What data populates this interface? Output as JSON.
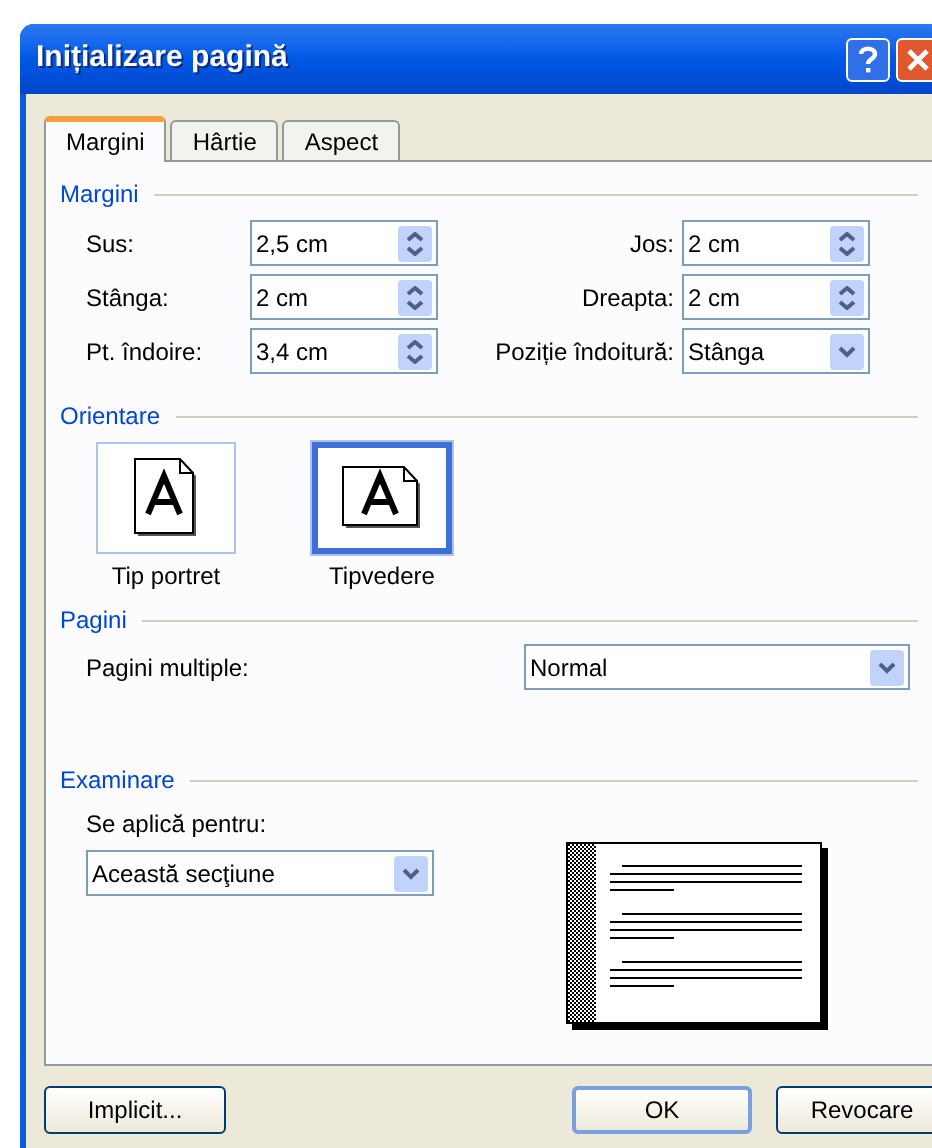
{
  "window": {
    "title": "Inițializare pagină"
  },
  "tabs": [
    {
      "label": "Margini",
      "selected": true
    },
    {
      "label": "Hârtie",
      "selected": false
    },
    {
      "label": "Aspect",
      "selected": false
    }
  ],
  "margins": {
    "heading": "Margini",
    "fields": [
      {
        "label": "Sus:",
        "value": "2,5 cm",
        "kind": "spin"
      },
      {
        "label": "Jos:",
        "value": "2 cm",
        "kind": "spin"
      },
      {
        "label": "Stânga:",
        "value": "2 cm",
        "kind": "spin"
      },
      {
        "label": "Dreapta:",
        "value": "2 cm",
        "kind": "spin"
      },
      {
        "label": "Pt. îndoire:",
        "value": "3,4 cm",
        "kind": "spin"
      },
      {
        "label": "Poziție îndoitură:",
        "value": "Stânga",
        "kind": "select"
      }
    ]
  },
  "orientation": {
    "heading": "Orientare",
    "options": [
      {
        "label": "Tip portret",
        "kind": "portrait",
        "selected": false
      },
      {
        "label": "Tipvedere",
        "kind": "landscape",
        "selected": true
      }
    ]
  },
  "pages": {
    "heading": "Pagini",
    "label": "Pagini multiple:",
    "value": "Normal"
  },
  "preview": {
    "heading": "Examinare",
    "apply_label": "Se aplică pentru:",
    "apply_value": "Această secţiune"
  },
  "buttons": [
    {
      "label": "Implicit...",
      "kind": "left"
    },
    {
      "label": "OK",
      "kind": "default"
    },
    {
      "label": "Revocare",
      "kind": "normal"
    }
  ]
}
